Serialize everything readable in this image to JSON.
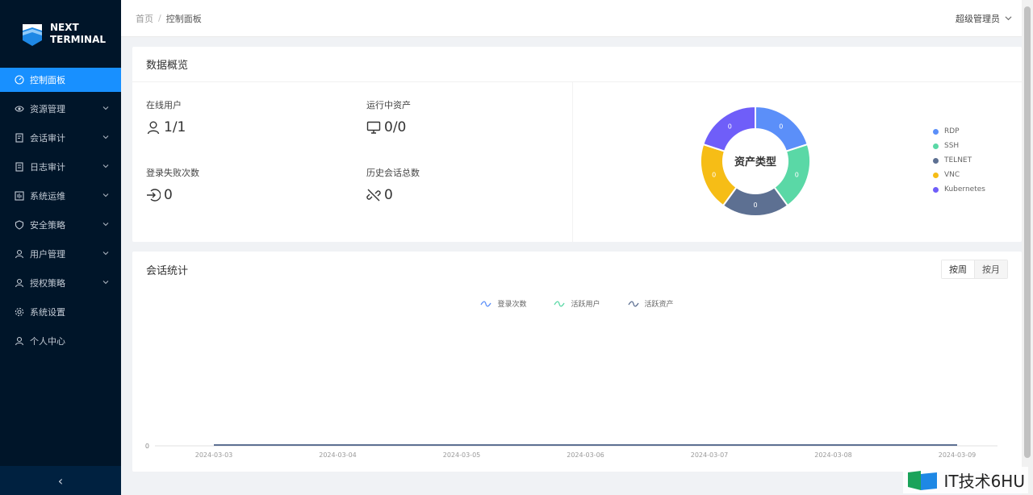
{
  "brand": {
    "line1": "NEXT",
    "line2": "TERMINAL"
  },
  "sidebar": {
    "items": [
      {
        "label": "控制面板",
        "icon": "dashboard-icon",
        "active": true,
        "expandable": false
      },
      {
        "label": "资源管理",
        "icon": "eye-icon",
        "active": false,
        "expandable": true
      },
      {
        "label": "会话审计",
        "icon": "audit-icon",
        "active": false,
        "expandable": true
      },
      {
        "label": "日志审计",
        "icon": "log-icon",
        "active": false,
        "expandable": true
      },
      {
        "label": "系统运维",
        "icon": "ops-icon",
        "active": false,
        "expandable": true
      },
      {
        "label": "安全策略",
        "icon": "shield-icon",
        "active": false,
        "expandable": true
      },
      {
        "label": "用户管理",
        "icon": "user-icon",
        "active": false,
        "expandable": true
      },
      {
        "label": "授权策略",
        "icon": "user-icon",
        "active": false,
        "expandable": true
      },
      {
        "label": "系统设置",
        "icon": "gear-icon",
        "active": false,
        "expandable": false
      },
      {
        "label": "个人中心",
        "icon": "user-icon",
        "active": false,
        "expandable": false
      }
    ],
    "collapse_glyph": "‹"
  },
  "header": {
    "breadcrumb": {
      "home": "首页",
      "sep": "/",
      "current": "控制面板"
    },
    "user": "超级管理员"
  },
  "overview": {
    "title": "数据概览",
    "stats": [
      {
        "label": "在线用户",
        "value": "1/1",
        "icon": "user-icon"
      },
      {
        "label": "运行中资产",
        "value": "0/0",
        "icon": "monitor-icon"
      },
      {
        "label": "登录失败次数",
        "value": "0",
        "icon": "login-icon"
      },
      {
        "label": "历史会话总数",
        "value": "0",
        "icon": "link-broken-icon"
      }
    ],
    "pie": {
      "center_label": "资产类型",
      "legend": [
        {
          "name": "RDP",
          "color": "#5b8ff9"
        },
        {
          "name": "SSH",
          "color": "#5ad8a6"
        },
        {
          "name": "TELNET",
          "color": "#5d7092"
        },
        {
          "name": "VNC",
          "color": "#f6bd16"
        },
        {
          "name": "Kubernetes",
          "color": "#6f5ef9"
        }
      ],
      "slice_label": "0"
    }
  },
  "sessions": {
    "title": "会话统计",
    "toggle": {
      "week": "按周",
      "month": "按月",
      "selected": "week"
    },
    "legend": [
      {
        "name": "登录次数",
        "color": "#5b8ff9"
      },
      {
        "name": "活跃用户",
        "color": "#5ad8a6"
      },
      {
        "name": "活跃资产",
        "color": "#5d7092"
      }
    ]
  },
  "chart_data": [
    {
      "type": "pie",
      "center_label": "资产类型",
      "categories": [
        "RDP",
        "SSH",
        "TELNET",
        "VNC",
        "Kubernetes"
      ],
      "values": [
        0,
        0,
        0,
        0,
        0
      ],
      "colors": [
        "#5b8ff9",
        "#5ad8a6",
        "#5d7092",
        "#f6bd16",
        "#6f5ef9"
      ],
      "legend": "right"
    },
    {
      "type": "line",
      "x": [
        "2024-03-03",
        "2024-03-04",
        "2024-03-05",
        "2024-03-06",
        "2024-03-07",
        "2024-03-08",
        "2024-03-09"
      ],
      "series": [
        {
          "name": "登录次数",
          "values": [
            0,
            0,
            0,
            0,
            0,
            0,
            0
          ],
          "color": "#5b8ff9"
        },
        {
          "name": "活跃用户",
          "values": [
            0,
            0,
            0,
            0,
            0,
            0,
            0
          ],
          "color": "#5ad8a6"
        },
        {
          "name": "活跃资产",
          "values": [
            0,
            0,
            0,
            0,
            0,
            0,
            0
          ],
          "color": "#5d7092"
        }
      ],
      "yticks": [
        "0"
      ],
      "legend": "top",
      "grid": false
    }
  ],
  "watermark": {
    "text": "IT技术6HU"
  }
}
